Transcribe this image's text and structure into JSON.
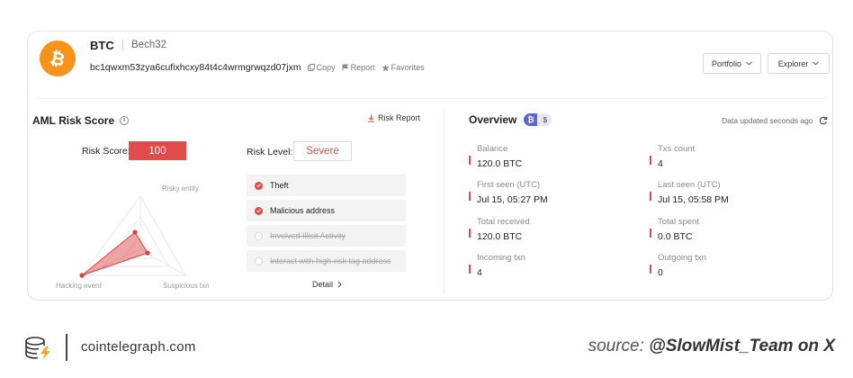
{
  "wallet": {
    "symbol": "BTC",
    "format": "Bech32",
    "address": "bc1qwxm53zya6cufixhcxy84t4c4wrmgrwqzd07jxm",
    "copy_label": "Copy",
    "report_label": "Report",
    "favorites_label": "Favorites",
    "logo_color": "#f7931a"
  },
  "header_buttons": {
    "portfolio": "Portfolio",
    "explorer": "Explorer"
  },
  "aml": {
    "title": "AML Risk Score",
    "risk_report_label": "Risk Report",
    "score_label": "Risk Score:",
    "score_value": "100",
    "level_label": "Risk Level:",
    "level_value": "Severe",
    "accent_color": "#e24b4b",
    "radar_axes": [
      "Risky entity",
      "Hacking event",
      "Suspicious txn"
    ],
    "tags": [
      {
        "label": "Theft",
        "active": true
      },
      {
        "label": "Malicious address",
        "active": true
      },
      {
        "label": "Involved Illicit Activity",
        "active": false
      },
      {
        "label": "Interact with high-risk tag address",
        "active": false
      }
    ],
    "detail_label": "Detail"
  },
  "overview": {
    "title": "Overview",
    "chain_btc_symbol": "₿",
    "chain_usd_symbol": "$",
    "updated_text": "Data updated seconds ago",
    "stats": [
      {
        "label": "Balance",
        "value": "120.0 BTC"
      },
      {
        "label": "Txs count",
        "value": "4"
      },
      {
        "label": "First seen (UTC)",
        "value": "Jul 15, 05:27 PM"
      },
      {
        "label": "Last seen (UTC)",
        "value": "Jul 15, 05:58 PM"
      },
      {
        "label": "Total received",
        "value": "120.0 BTC"
      },
      {
        "label": "Total spent",
        "value": "0.0 BTC"
      },
      {
        "label": "Incoming txn",
        "value": "4"
      },
      {
        "label": "Outgoing txn",
        "value": "0"
      }
    ]
  },
  "footer": {
    "site": "cointelegraph.com",
    "source_prefix": "source: ",
    "source_handle": "@SlowMist_Team on X"
  }
}
